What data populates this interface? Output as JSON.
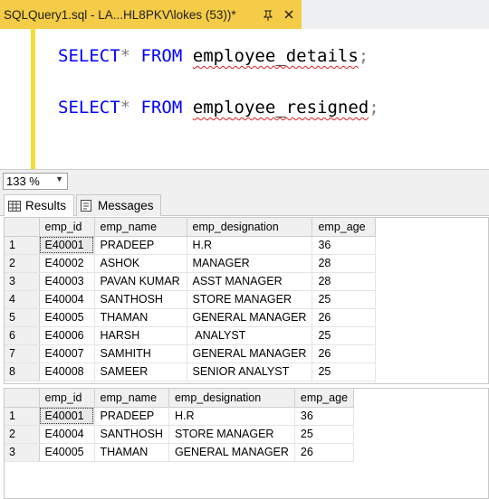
{
  "tab": {
    "title": "SQLQuery1.sql - LA...HL8PKV\\lokes (53))*"
  },
  "editor": {
    "line1": {
      "kw1": "SELECT",
      "op": "*",
      "kw2": "FROM",
      "table": "employee_details",
      "semi": ";"
    },
    "line2": {
      "kw1": "SELECT",
      "op": "*",
      "kw2": "FROM",
      "table": "employee_resigned",
      "semi": ";"
    }
  },
  "zoom": {
    "value": "133 %"
  },
  "result_tabs": [
    {
      "label": "Results"
    },
    {
      "label": "Messages"
    }
  ],
  "grid1": {
    "columns": [
      "emp_id",
      "emp_name",
      "emp_designation",
      "emp_age"
    ],
    "rows": [
      [
        "1",
        "E40001",
        "PRADEEP",
        "H.R",
        "36"
      ],
      [
        "2",
        "E40002",
        "ASHOK",
        "MANAGER",
        "28"
      ],
      [
        "3",
        "E40003",
        "PAVAN KUMAR",
        "ASST MANAGER",
        "28"
      ],
      [
        "4",
        "E40004",
        "SANTHOSH",
        "STORE MANAGER",
        "25"
      ],
      [
        "5",
        "E40005",
        "THAMAN",
        "GENERAL MANAGER",
        "26"
      ],
      [
        "6",
        "E40006",
        "HARSH",
        " ANALYST",
        "25"
      ],
      [
        "7",
        "E40007",
        "SAMHITH",
        "GENERAL MANAGER",
        "26"
      ],
      [
        "8",
        "E40008",
        "SAMEER",
        "SENIOR ANALYST",
        "25"
      ]
    ]
  },
  "grid2": {
    "columns": [
      "emp_id",
      "emp_name",
      "emp_designation",
      "emp_age"
    ],
    "rows": [
      [
        "1",
        "E40001",
        "PRADEEP",
        "H.R",
        "36"
      ],
      [
        "2",
        "E40004",
        "SANTHOSH",
        "STORE MANAGER",
        "25"
      ],
      [
        "3",
        "E40005",
        "THAMAN",
        "GENERAL MANAGER",
        "26"
      ]
    ]
  },
  "colors": {
    "tab_active": "#f5cc47",
    "keyword": "#0000ff",
    "change_bar": "#f0de3a",
    "squiggle": "#e02020"
  }
}
